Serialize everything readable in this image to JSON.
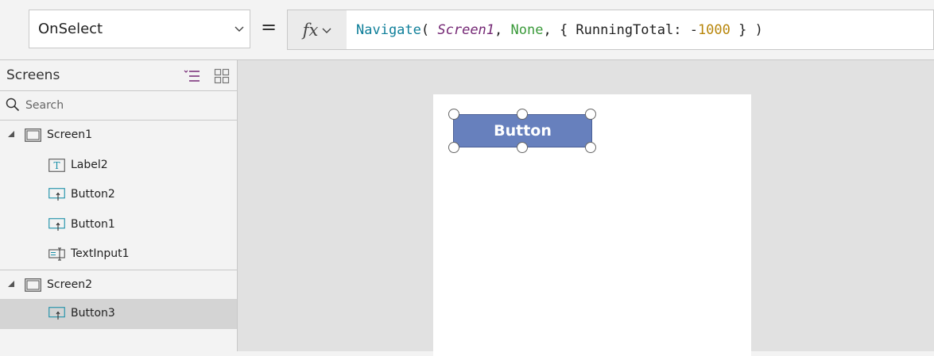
{
  "formula_bar": {
    "property": "OnSelect",
    "equals": "=",
    "fx_label": "fx",
    "formula": {
      "fn": "Navigate",
      "open": "( ",
      "control": "Screen1",
      "comma1": ", ",
      "transition": "None",
      "rest1": ", { RunningTotal: -",
      "number": "1000",
      "rest2": " } )"
    }
  },
  "tree": {
    "title": "Screens",
    "search_placeholder": "Search",
    "screens": [
      {
        "label": "Screen1",
        "children": [
          "Label2",
          "Button2",
          "Button1",
          "TextInput1"
        ]
      },
      {
        "label": "Screen2",
        "children": [
          "Button3"
        ]
      }
    ],
    "selected": "Button3"
  },
  "canvas": {
    "button_label": "Button"
  }
}
